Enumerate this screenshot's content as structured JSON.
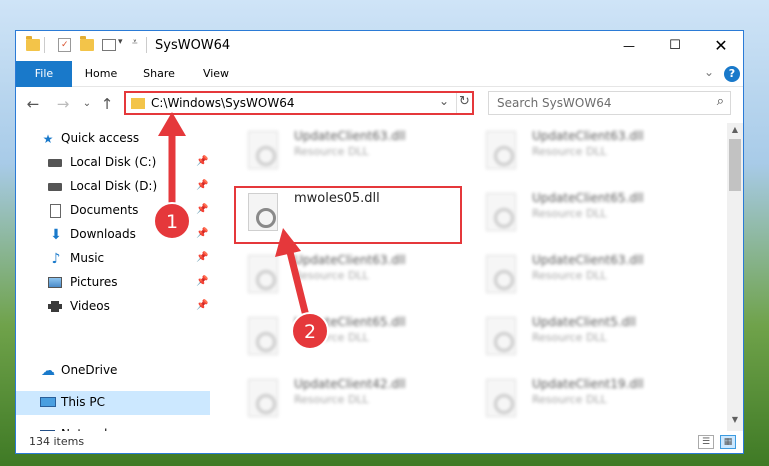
{
  "window": {
    "title": "SysWOW64",
    "minimize": "—",
    "maximize": "☐",
    "close": "✕"
  },
  "ribbon": {
    "tabs": [
      "File",
      "Home",
      "Share",
      "View"
    ],
    "collapse": "⌄",
    "help": "?"
  },
  "nav": {
    "back": "←",
    "forward": "→",
    "recent": "⌄",
    "up": "↑",
    "address": "C:\\Windows\\SysWOW64",
    "address_dropdown": "⌄",
    "refresh": "↻",
    "search_placeholder": "Search SysWOW64",
    "search_icon": "⌕"
  },
  "sidebar": {
    "items": [
      {
        "label": "Quick access",
        "icon": "star-icon"
      },
      {
        "label": "Local Disk (C:)",
        "icon": "drive-icon"
      },
      {
        "label": "Local Disk (D:)",
        "icon": "drive-icon"
      },
      {
        "label": "Documents",
        "icon": "documents-icon"
      },
      {
        "label": "Downloads",
        "icon": "downloads-icon"
      },
      {
        "label": "Music",
        "icon": "music-icon"
      },
      {
        "label": "Pictures",
        "icon": "pictures-icon"
      },
      {
        "label": "Videos",
        "icon": "videos-icon"
      },
      {
        "label": "OneDrive",
        "icon": "cloud-icon"
      },
      {
        "label": "This PC",
        "icon": "computer-icon"
      },
      {
        "label": "Network",
        "icon": "network-icon"
      }
    ]
  },
  "files": [
    {
      "name": "UpdateClient63.dll",
      "type": "Resource DLL"
    },
    {
      "name": "UpdateClient63.dll",
      "type": "Resource DLL"
    },
    {
      "name": "mwoles05.dll",
      "type": ""
    },
    {
      "name": "UpdateClient65.dll",
      "type": "Resource DLL"
    },
    {
      "name": "UpdateClient63.dll",
      "type": "Resource DLL"
    },
    {
      "name": "UpdateClient63.dll",
      "type": "Resource DLL"
    },
    {
      "name": "UpdateClient65.dll",
      "type": "Resource DLL"
    },
    {
      "name": "UpdateClient5.dll",
      "type": "Resource DLL"
    },
    {
      "name": "UpdateClient42.dll",
      "type": "Resource DLL"
    },
    {
      "name": "UpdateClient19.dll",
      "type": "Resource DLL"
    }
  ],
  "status": {
    "item_count": "134 items"
  },
  "annotations": {
    "step1": "1",
    "step2": "2",
    "color": "#e5383b"
  }
}
